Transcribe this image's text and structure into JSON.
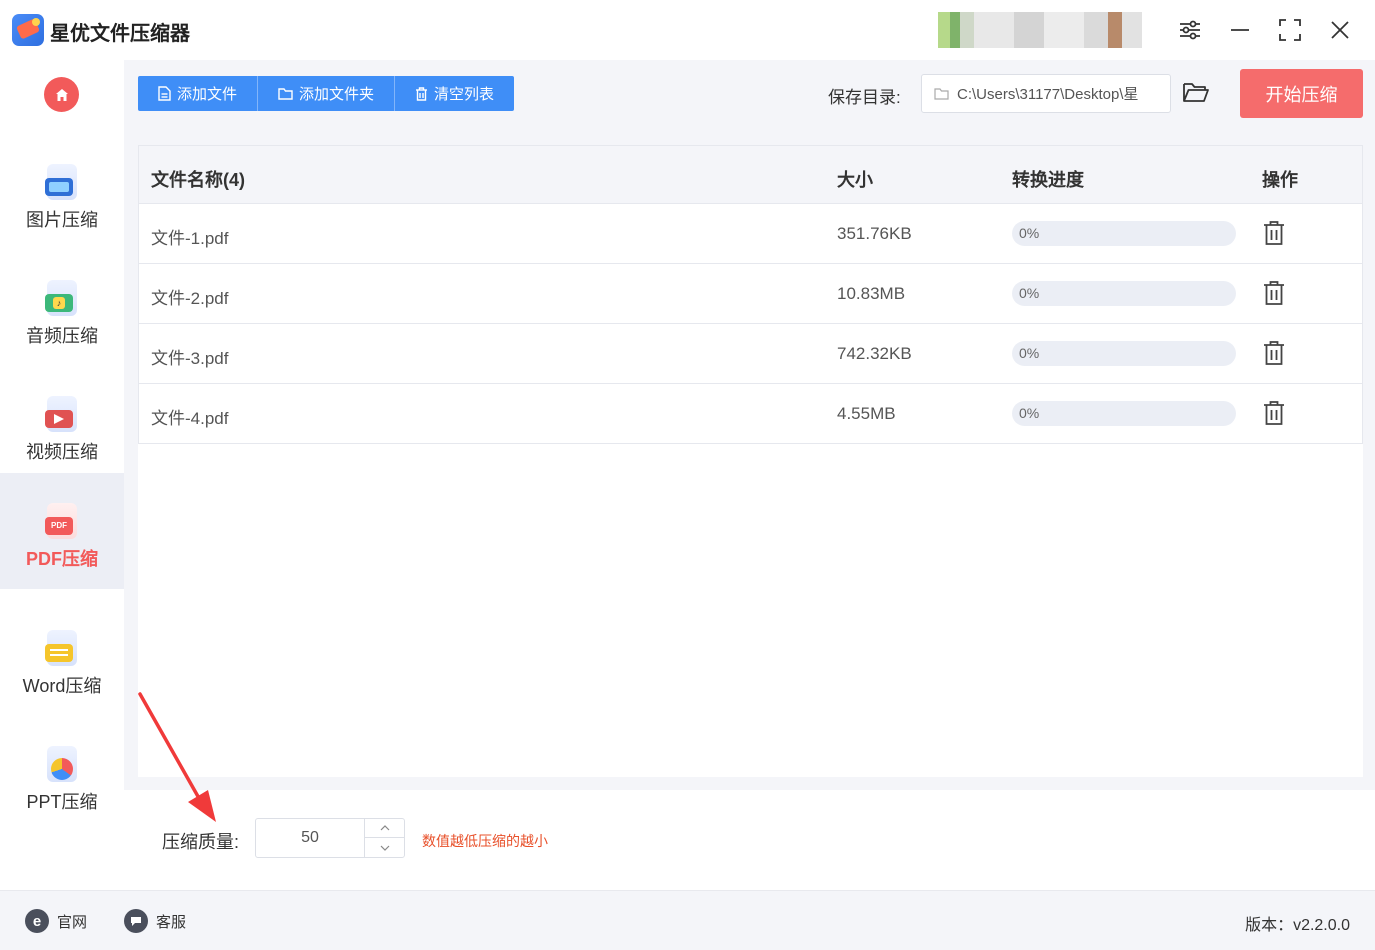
{
  "app": {
    "title": "星优文件压缩器"
  },
  "sidebar": {
    "items": [
      {
        "label": "图片压缩",
        "icon": "image-icon",
        "active": false
      },
      {
        "label": "音频压缩",
        "icon": "music-icon",
        "active": false
      },
      {
        "label": "视频压缩",
        "icon": "video-icon",
        "active": false
      },
      {
        "label": "PDF压缩",
        "icon": "pdf-icon",
        "active": true
      },
      {
        "label": "Word压缩",
        "icon": "word-icon",
        "active": false
      },
      {
        "label": "PPT压缩",
        "icon": "ppt-icon",
        "active": false
      }
    ]
  },
  "toolbar": {
    "add_file": "添加文件",
    "add_folder": "添加文件夹",
    "clear_list": "清空列表",
    "save_dir_label": "保存目录:",
    "save_dir_path": "C:\\Users\\31177\\Desktop\\星",
    "start_button": "开始压缩"
  },
  "table": {
    "headers": {
      "name": "文件名称(4)",
      "size": "大小",
      "progress": "转换进度",
      "action": "操作"
    },
    "rows": [
      {
        "name": "文件-1.pdf",
        "size": "351.76KB",
        "progress_text": "0%",
        "progress": 0
      },
      {
        "name": "文件-2.pdf",
        "size": "10.83MB",
        "progress_text": "0%",
        "progress": 0
      },
      {
        "name": "文件-3.pdf",
        "size": "742.32KB",
        "progress_text": "0%",
        "progress": 0
      },
      {
        "name": "文件-4.pdf",
        "size": "4.55MB",
        "progress_text": "0%",
        "progress": 0
      }
    ]
  },
  "settings": {
    "quality_label": "压缩质量:",
    "quality_value": "50",
    "hint": "数值越低压缩的越小"
  },
  "footer": {
    "website": "官网",
    "support": "客服",
    "version": "版本：v2.2.0.0"
  },
  "colors": {
    "accent_blue": "#3f8ef7",
    "accent_red": "#f56c6c",
    "hint_orange": "#e8502a"
  }
}
